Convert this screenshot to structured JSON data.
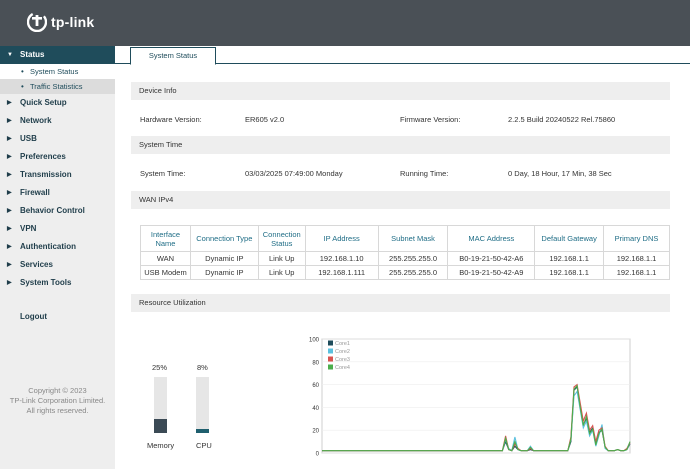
{
  "brand": {
    "name": "tp-link"
  },
  "sidebar": {
    "status": "Status",
    "sub_system_status": "System Status",
    "sub_traffic": "Traffic Statistics",
    "quick_setup": "Quick Setup",
    "network": "Network",
    "usb": "USB",
    "preferences": "Preferences",
    "transmission": "Transmission",
    "firewall": "Firewall",
    "behavior_control": "Behavior Control",
    "vpn": "VPN",
    "authentication": "Authentication",
    "services": "Services",
    "system_tools": "System Tools",
    "logout": "Logout",
    "copyright1": "Copyright © 2023",
    "copyright2": "TP-Link Corporation Limited.",
    "copyright3": "All rights reserved."
  },
  "tab": {
    "label": "System Status"
  },
  "device_info": {
    "heading": "Device Info",
    "hw_label": "Hardware Version:",
    "hw_value": "ER605 v2.0",
    "fw_label": "Firmware Version:",
    "fw_value": "2.2.5 Build 20240522 Rel.75860"
  },
  "system_time": {
    "heading": "System Time",
    "time_label": "System Time:",
    "time_value": "03/03/2025 07:49:00 Monday",
    "run_label": "Running Time:",
    "run_value": "0 Day, 18 Hour, 17 Min, 38 Sec"
  },
  "wan": {
    "heading": "WAN IPv4",
    "headers": [
      "Interface Name",
      "Connection Type",
      "Connection Status",
      "IP Address",
      "Subnet Mask",
      "MAC Address",
      "Default Gateway",
      "Primary DNS"
    ],
    "rows": [
      [
        "WAN",
        "Dynamic IP",
        "Link Up",
        "192.168.1.10",
        "255.255.255.0",
        "B0-19-21-50-42-A6",
        "192.168.1.1",
        "192.168.1.1"
      ],
      [
        "USB Modem",
        "Dynamic IP",
        "Link Up",
        "192.168.1.111",
        "255.255.255.0",
        "B0-19-21-50-42-A9",
        "192.168.1.1",
        "192.168.1.1"
      ]
    ]
  },
  "resource": {
    "heading": "Resource Utilization",
    "memory_label": "Memory",
    "memory_pct": "25%",
    "memory_value": 25,
    "cpu_label": "CPU",
    "cpu_pct": "8%",
    "cpu_value": 8,
    "memory_color": "#3b4a55",
    "cpu_color": "#1f5f6e"
  },
  "chart_data": {
    "type": "line",
    "ylim": [
      0,
      100
    ],
    "y_ticks": [
      "0",
      "20",
      "40",
      "60",
      "80",
      "100"
    ],
    "series": [
      {
        "name": "Core1",
        "color": "#1f4c5b",
        "values": [
          2,
          2,
          2,
          2,
          2,
          2,
          2,
          2,
          2,
          2,
          2,
          2,
          2,
          2,
          2,
          2,
          2,
          2,
          2,
          2,
          2,
          2,
          2,
          2,
          2,
          2,
          2,
          2,
          2,
          2,
          2,
          2,
          2,
          2,
          2,
          2,
          2,
          2,
          2,
          2,
          2,
          2,
          2,
          2,
          2,
          2,
          2,
          2,
          2,
          2,
          2,
          2,
          2,
          2,
          2,
          2,
          2,
          2,
          2,
          10,
          3,
          2,
          6,
          3,
          2,
          2,
          2,
          3,
          2,
          2,
          2,
          2,
          2,
          2,
          2,
          2,
          2,
          2,
          2,
          2,
          10,
          55,
          58,
          42,
          25,
          30,
          18,
          22,
          8,
          18,
          20,
          5,
          2,
          2,
          2,
          3,
          2,
          2,
          3,
          8
        ]
      },
      {
        "name": "Core2",
        "color": "#5bc0de",
        "values": [
          2,
          2,
          2,
          2,
          2,
          2,
          2,
          2,
          2,
          2,
          2,
          2,
          2,
          2,
          2,
          2,
          2,
          2,
          2,
          2,
          2,
          2,
          2,
          2,
          2,
          2,
          2,
          2,
          2,
          2,
          2,
          2,
          2,
          2,
          2,
          2,
          2,
          2,
          2,
          2,
          2,
          2,
          2,
          2,
          2,
          2,
          2,
          2,
          2,
          2,
          2,
          2,
          2,
          2,
          2,
          2,
          2,
          2,
          2,
          12,
          4,
          2,
          14,
          3,
          2,
          2,
          2,
          6,
          2,
          2,
          2,
          2,
          2,
          2,
          2,
          2,
          2,
          2,
          2,
          2,
          12,
          50,
          54,
          38,
          22,
          28,
          15,
          20,
          6,
          15,
          25,
          4,
          2,
          2,
          2,
          3,
          2,
          2,
          3,
          9
        ]
      },
      {
        "name": "Core3",
        "color": "#d9534f",
        "values": [
          2,
          2,
          2,
          2,
          2,
          2,
          2,
          2,
          2,
          2,
          2,
          2,
          2,
          2,
          2,
          2,
          2,
          2,
          2,
          2,
          2,
          2,
          2,
          2,
          2,
          2,
          2,
          2,
          2,
          2,
          2,
          2,
          2,
          2,
          2,
          2,
          2,
          2,
          2,
          2,
          2,
          2,
          2,
          2,
          2,
          2,
          2,
          2,
          2,
          2,
          2,
          2,
          2,
          2,
          2,
          2,
          2,
          2,
          2,
          15,
          3,
          2,
          8,
          4,
          2,
          2,
          2,
          4,
          2,
          2,
          2,
          2,
          2,
          2,
          2,
          2,
          2,
          2,
          2,
          2,
          14,
          58,
          60,
          44,
          28,
          35,
          20,
          24,
          10,
          20,
          22,
          6,
          2,
          2,
          2,
          3,
          2,
          2,
          4,
          9
        ]
      },
      {
        "name": "Core4",
        "color": "#4cae4c",
        "values": [
          2,
          2,
          2,
          2,
          2,
          2,
          2,
          2,
          2,
          2,
          2,
          2,
          2,
          2,
          2,
          2,
          2,
          2,
          2,
          2,
          2,
          2,
          2,
          2,
          2,
          2,
          2,
          2,
          2,
          2,
          2,
          2,
          2,
          2,
          2,
          2,
          2,
          2,
          2,
          2,
          2,
          2,
          2,
          2,
          2,
          2,
          2,
          2,
          2,
          2,
          2,
          2,
          2,
          2,
          2,
          2,
          2,
          2,
          2,
          13,
          3,
          2,
          10,
          3,
          2,
          2,
          2,
          5,
          2,
          2,
          2,
          2,
          2,
          2,
          2,
          2,
          2,
          2,
          2,
          2,
          12,
          56,
          59,
          40,
          24,
          32,
          17,
          21,
          7,
          17,
          21,
          5,
          2,
          2,
          2,
          3,
          2,
          2,
          3,
          10
        ]
      }
    ]
  }
}
